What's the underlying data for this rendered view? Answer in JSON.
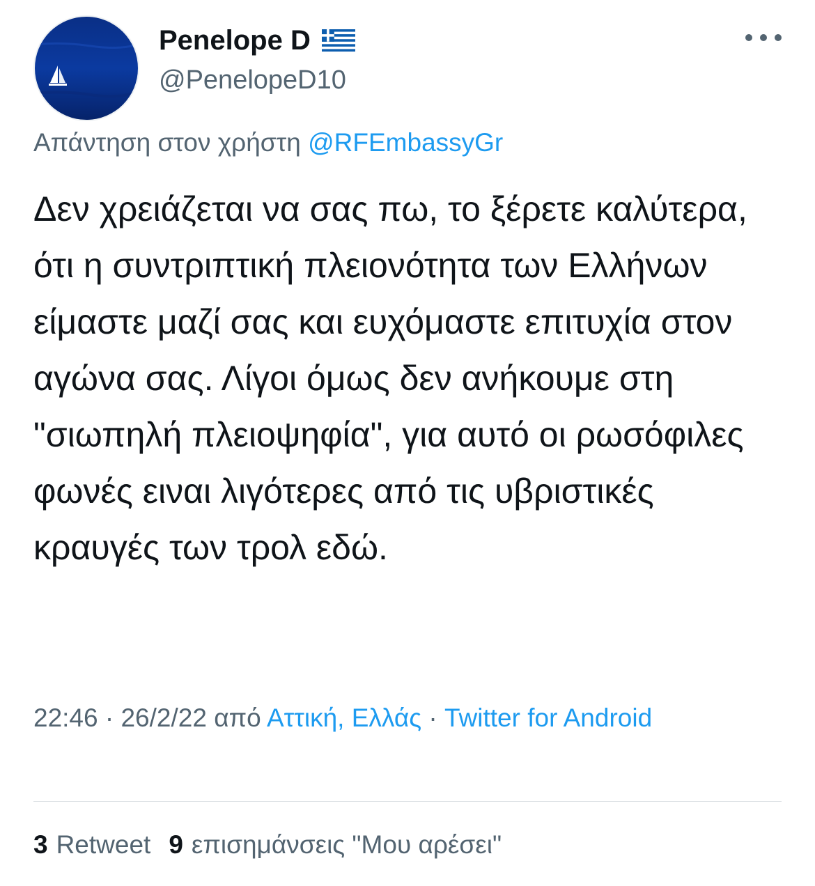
{
  "user": {
    "display_name": "Penelope D",
    "handle": "@PenelopeD10",
    "flag_icon": "greece-flag-icon",
    "avatar_icon": "sailboat-on-sea-avatar"
  },
  "reply": {
    "prefix": "Απάντηση στον χρήστη",
    "mention": "@RFEmbassyGr"
  },
  "tweet": {
    "text": "Δεν χρειάζεται να σας πω, το ξέρετε καλύτερα, ότι η συντριπτική πλειονότητα των Ελλήνων είμαστε μαζί σας και ευχόμαστε επιτυχία στον αγώνα σας. Λίγοι όμως δεν ανήκουμε στη \"σιωπηλή πλειοψηφία\", για αυτό οι ρωσόφιλες φωνές ειναι λιγότερες από τις υβριστικές κραυγές των τρολ εδώ."
  },
  "meta": {
    "time": "22:46",
    "separator": "·",
    "date": "26/2/22",
    "from": "από",
    "location": "Αττική, Ελλάς",
    "source": "Twitter for Android"
  },
  "stats": {
    "retweets_count": "3",
    "retweets_label": "Retweet",
    "likes_count": "9",
    "likes_label": "επισημάνσεις \"Μου αρέσει\""
  },
  "colors": {
    "text": "#0f1419",
    "secondary": "#536471",
    "accent": "#1d9bf0",
    "divider": "#d9dee2",
    "flag_blue": "#0d5eaf"
  }
}
